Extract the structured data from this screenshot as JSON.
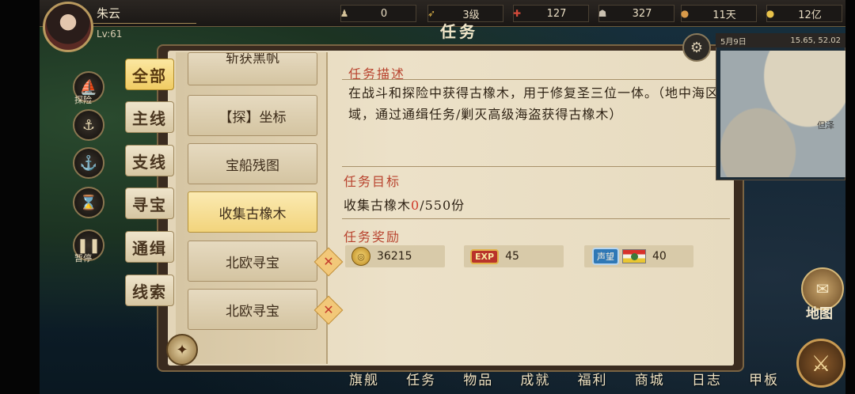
{
  "player": {
    "name": "朱云",
    "level": "Lv:61"
  },
  "resources": [
    {
      "icon": "sailor-icon",
      "glyph": "♟",
      "value": "0",
      "color": "#d6c39a"
    },
    {
      "icon": "rank-icon",
      "glyph": "➶",
      "value": "3级",
      "color": "#e2b74a"
    },
    {
      "icon": "crew-icon",
      "glyph": "✚",
      "value": "127",
      "color": "#d44a3a"
    },
    {
      "icon": "officer-icon",
      "glyph": "☗",
      "value": "327",
      "color": "#c9c0b0"
    },
    {
      "icon": "food-icon",
      "glyph": "●",
      "value": "11天",
      "color": "#d99a4a"
    },
    {
      "icon": "gold-icon",
      "glyph": "●",
      "value": "12亿",
      "color": "#e8c24a"
    }
  ],
  "page_title": "任务",
  "side_icons": [
    {
      "name": "explore-icon",
      "glyph": "⛵",
      "label": "探险"
    },
    {
      "name": "ship-icon",
      "glyph": "⚓︎",
      "label": ""
    },
    {
      "name": "anchor-icon",
      "glyph": "⚓",
      "label": ""
    },
    {
      "name": "hourglass-icon",
      "glyph": "⌛",
      "label": ""
    },
    {
      "name": "pause-icon",
      "glyph": "❚❚",
      "label": "暂停"
    }
  ],
  "categories": [
    "全部",
    "主线",
    "支线",
    "寻宝",
    "通缉",
    "线索"
  ],
  "quest_list": [
    "斩获黑帆",
    "【探】坐标",
    "宝船残图",
    "收集古橡木",
    "北欧寻宝",
    "北欧寻宝"
  ],
  "quest_badge": "✕",
  "detail": {
    "desc_title": "任务描述",
    "desc_text": "在战斗和探险中获得古橡木，用于修复圣三位一体。（地中海区域，通过通缉任务/剿灭高级海盗获得古橡木）",
    "goal_title": "任务目标",
    "goal_prefix": "收集古橡木",
    "goal_current": "0",
    "goal_total": "/550份",
    "reward_title": "任务奖励",
    "rewards": {
      "gold": "36215",
      "exp_label": "EXP",
      "exp": "45",
      "rep_label": "声望",
      "rep": "40"
    }
  },
  "close_label": "✕",
  "minimap": {
    "date": "5月9日",
    "coords": "15.65, 52.02",
    "place": "但泽"
  },
  "map_button": "地图",
  "combat_glyph": "⚔",
  "settings_glyph": "⚙",
  "compass_glyph": "✦",
  "bottom_nav": [
    "旗舰",
    "任务",
    "物品",
    "成就",
    "福利",
    "商城",
    "日志",
    "甲板"
  ]
}
